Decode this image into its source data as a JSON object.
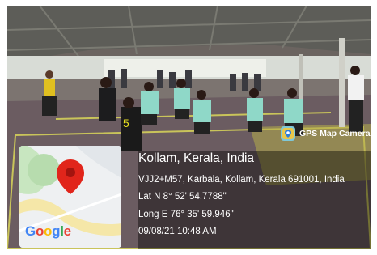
{
  "photo": {
    "description_icon": "photo-scene",
    "colors": {
      "floor": "#6e5e62",
      "roof": "#5a5a55",
      "court_line": "#c9c45a"
    }
  },
  "map": {
    "logo_text": "Google",
    "marker_icon": "map-pin-icon",
    "marker_color": "#e1251b"
  },
  "badge": {
    "label": "GPS Map Camera",
    "icon": "camera-pin-icon"
  },
  "location": {
    "title": "Kollam, Kerala, India",
    "address": "VJJ2+M57, Karbala, Kollam, Kerala 691001, India",
    "latitude": "Lat N 8° 52' 54.7788\"",
    "longitude": "Long E 76° 35' 59.946\"",
    "datetime": "09/08/21 10:48 AM"
  }
}
